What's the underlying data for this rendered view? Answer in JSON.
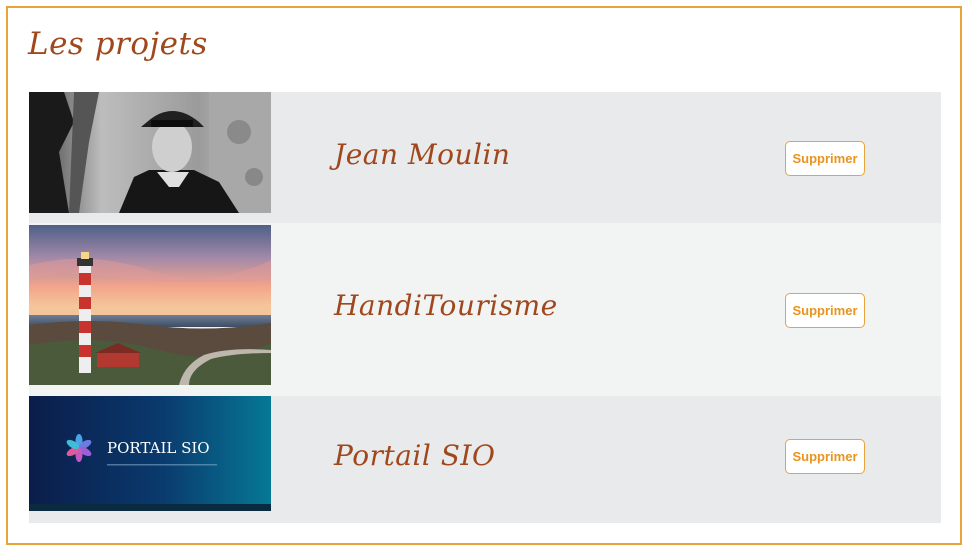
{
  "page": {
    "title": "Les projets"
  },
  "projects": [
    {
      "name": "Jean Moulin",
      "image": "portrait-photo",
      "delete_label": "Supprimer"
    },
    {
      "name": "HandiTourisme",
      "image": "lighthouse-photo",
      "delete_label": "Supprimer"
    },
    {
      "name": "Portail SIO",
      "image": "portail-sio-banner",
      "delete_label": "Supprimer",
      "banner_text": "PORTAIL SIO"
    }
  ],
  "colors": {
    "accent_orange": "#e8a43a",
    "title_brown": "#a0481d",
    "row_gray": "#e9eaec",
    "row_light": "#f2f3f3"
  }
}
